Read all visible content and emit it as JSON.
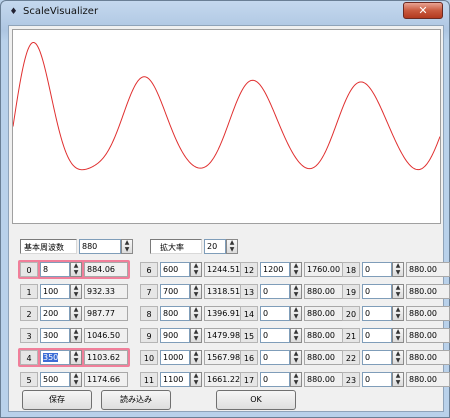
{
  "window": {
    "title": "ScaleVisualizer",
    "close_symbol": "✕"
  },
  "waveform": {
    "color": "#e03030"
  },
  "base_freq": {
    "label": "基本周波数",
    "value": "880"
  },
  "zoom": {
    "label": "拡大率",
    "value": "20"
  },
  "rows": [
    {
      "index": "0",
      "value": "8",
      "freq": "884.06",
      "highlight": true
    },
    {
      "index": "1",
      "value": "100",
      "freq": "932.33"
    },
    {
      "index": "2",
      "value": "200",
      "freq": "987.77"
    },
    {
      "index": "3",
      "value": "300",
      "freq": "1046.50"
    },
    {
      "index": "4",
      "value": "350",
      "freq": "1103.62",
      "highlight": true,
      "selected": true
    },
    {
      "index": "5",
      "value": "500",
      "freq": "1174.66"
    },
    {
      "index": "6",
      "value": "600",
      "freq": "1244.51"
    },
    {
      "index": "7",
      "value": "700",
      "freq": "1318.51"
    },
    {
      "index": "8",
      "value": "800",
      "freq": "1396.91"
    },
    {
      "index": "9",
      "value": "900",
      "freq": "1479.98"
    },
    {
      "index": "10",
      "value": "1000",
      "freq": "1567.98"
    },
    {
      "index": "11",
      "value": "1100",
      "freq": "1661.22"
    },
    {
      "index": "12",
      "value": "1200",
      "freq": "1760.00"
    },
    {
      "index": "13",
      "value": "0",
      "freq": "880.00"
    },
    {
      "index": "14",
      "value": "0",
      "freq": "880.00"
    },
    {
      "index": "15",
      "value": "0",
      "freq": "880.00"
    },
    {
      "index": "16",
      "value": "0",
      "freq": "880.00"
    },
    {
      "index": "17",
      "value": "0",
      "freq": "880.00"
    },
    {
      "index": "18",
      "value": "0",
      "freq": "880.00"
    },
    {
      "index": "19",
      "value": "0",
      "freq": "880.00"
    },
    {
      "index": "20",
      "value": "0",
      "freq": "880.00"
    },
    {
      "index": "21",
      "value": "0",
      "freq": "880.00"
    },
    {
      "index": "22",
      "value": "0",
      "freq": "880.00"
    },
    {
      "index": "23",
      "value": "0",
      "freq": "880.00"
    }
  ],
  "buttons": {
    "save": "保存",
    "load": "読み込み",
    "ok": "OK"
  },
  "spin": {
    "up": "▲",
    "down": "▼"
  }
}
